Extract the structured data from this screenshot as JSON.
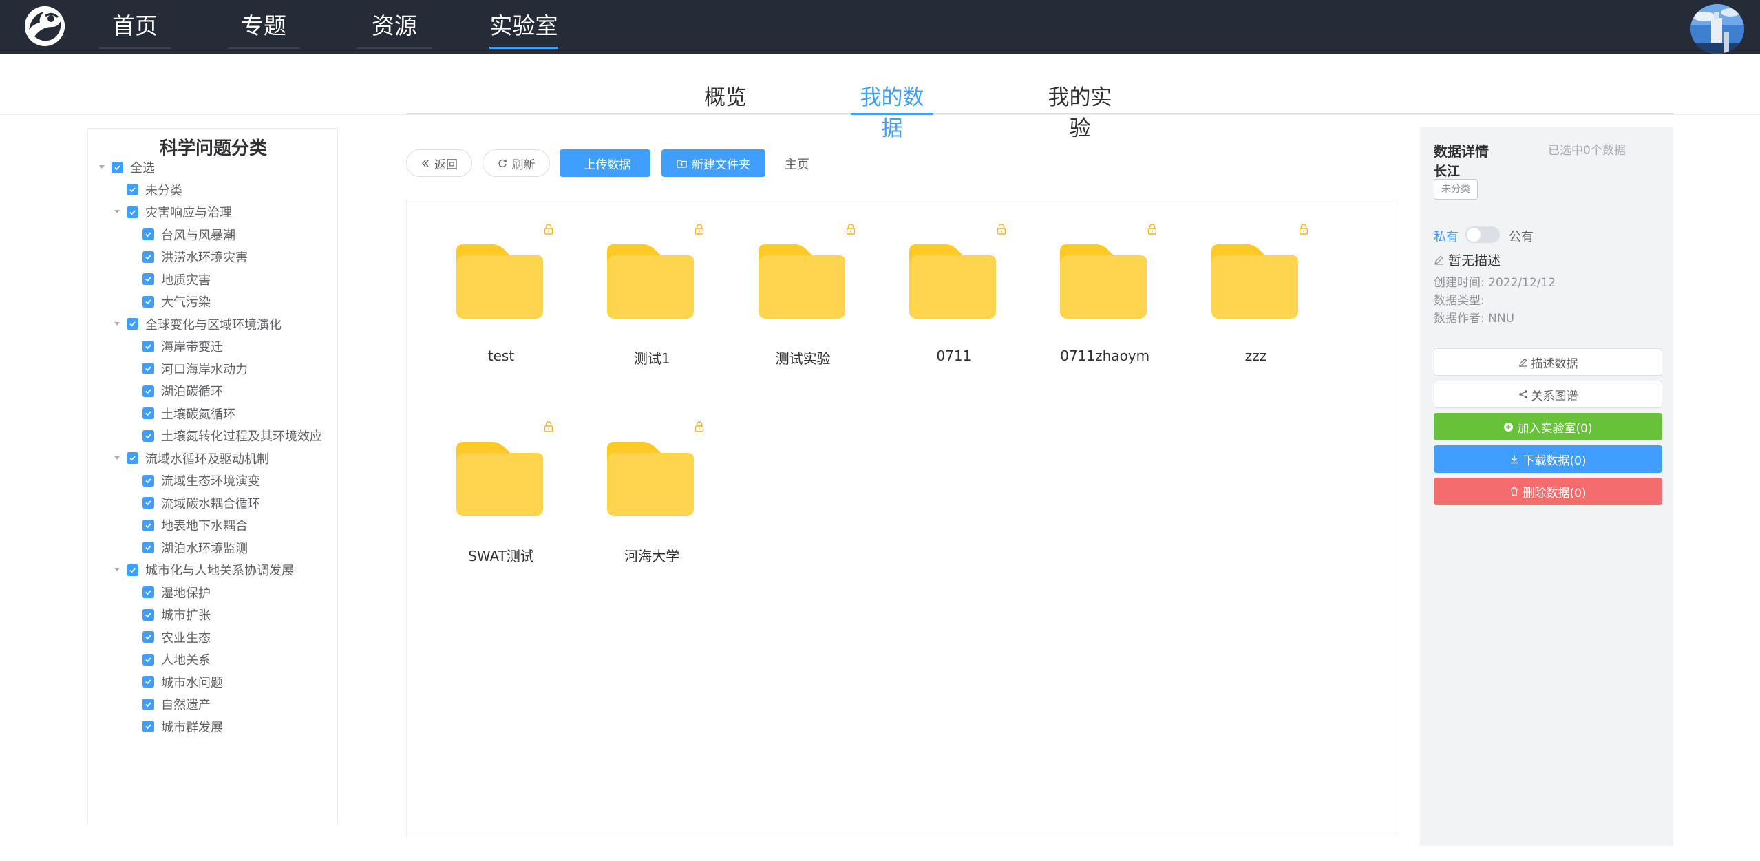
{
  "nav": {
    "items": [
      {
        "label": "首页",
        "active": false
      },
      {
        "label": "专题",
        "active": false
      },
      {
        "label": "资源",
        "active": false
      },
      {
        "label": "实验室",
        "active": true
      }
    ]
  },
  "subtabs": [
    {
      "label": "概览",
      "active": false
    },
    {
      "label": "我的数据",
      "active": true
    },
    {
      "label": "我的实验",
      "active": false
    }
  ],
  "tree": {
    "title": "科学问题分类",
    "nodes": [
      {
        "label": "全选",
        "level": 0,
        "expandable": true,
        "checked": true
      },
      {
        "label": "未分类",
        "level": 1,
        "expandable": false,
        "checked": true
      },
      {
        "label": "灾害响应与治理",
        "level": 1,
        "expandable": true,
        "checked": true
      },
      {
        "label": "台风与风暴潮",
        "level": 2,
        "expandable": false,
        "checked": true
      },
      {
        "label": "洪涝水环境灾害",
        "level": 2,
        "expandable": false,
        "checked": true
      },
      {
        "label": "地质灾害",
        "level": 2,
        "expandable": false,
        "checked": true
      },
      {
        "label": "大气污染",
        "level": 2,
        "expandable": false,
        "checked": true
      },
      {
        "label": "全球变化与区域环境演化",
        "level": 1,
        "expandable": true,
        "checked": true
      },
      {
        "label": "海岸带变迁",
        "level": 2,
        "expandable": false,
        "checked": true
      },
      {
        "label": "河口海岸水动力",
        "level": 2,
        "expandable": false,
        "checked": true
      },
      {
        "label": "湖泊碳循环",
        "level": 2,
        "expandable": false,
        "checked": true
      },
      {
        "label": "土壤碳氮循环",
        "level": 2,
        "expandable": false,
        "checked": true
      },
      {
        "label": "土壤氮转化过程及其环境效应",
        "level": 2,
        "expandable": false,
        "checked": true
      },
      {
        "label": "流域水循环及驱动机制",
        "level": 1,
        "expandable": true,
        "checked": true
      },
      {
        "label": "流域生态环境演变",
        "level": 2,
        "expandable": false,
        "checked": true
      },
      {
        "label": "流域碳水耦合循环",
        "level": 2,
        "expandable": false,
        "checked": true
      },
      {
        "label": "地表地下水耦合",
        "level": 2,
        "expandable": false,
        "checked": true
      },
      {
        "label": "湖泊水环境监测",
        "level": 2,
        "expandable": false,
        "checked": true
      },
      {
        "label": "城市化与人地关系协调发展",
        "level": 1,
        "expandable": true,
        "checked": true
      },
      {
        "label": "湿地保护",
        "level": 2,
        "expandable": false,
        "checked": true
      },
      {
        "label": "城市扩张",
        "level": 2,
        "expandable": false,
        "checked": true
      },
      {
        "label": "农业生态",
        "level": 2,
        "expandable": false,
        "checked": true
      },
      {
        "label": "人地关系",
        "level": 2,
        "expandable": false,
        "checked": true
      },
      {
        "label": "城市水问题",
        "level": 2,
        "expandable": false,
        "checked": true
      },
      {
        "label": "自然遗产",
        "level": 2,
        "expandable": false,
        "checked": true
      },
      {
        "label": "城市群发展",
        "level": 2,
        "expandable": false,
        "checked": true
      }
    ]
  },
  "toolbar": {
    "back_label": "返回",
    "refresh_label": "刷新",
    "upload_label": "上传数据",
    "new_folder_label": "新建文件夹",
    "breadcrumb": "主页"
  },
  "files": [
    {
      "name": "test",
      "locked": true
    },
    {
      "name": "测试1",
      "locked": true
    },
    {
      "name": "测试实验",
      "locked": true
    },
    {
      "name": "0711",
      "locked": true
    },
    {
      "name": "0711zhaoym",
      "locked": true
    },
    {
      "name": "zzz",
      "locked": true
    },
    {
      "name": "SWAT测试",
      "locked": true
    },
    {
      "name": "河海大学",
      "locked": true
    }
  ],
  "details": {
    "title": "数据详情",
    "selected_count": "已选中0个数据",
    "name": "长江",
    "tag": "未分类",
    "private_label": "私有",
    "public_label": "公有",
    "description": "暂无描述",
    "created": "创建时间:  2022/12/12",
    "data_type": "数据类型:",
    "author": "数据作者:  NNU",
    "describe_btn": "描述数据",
    "graph_btn": "关系图谱",
    "add_lab_btn": "加入实验室(0)",
    "download_btn": "下载数据(0)",
    "delete_btn": "删除数据(0)"
  },
  "colors": {
    "accent": "#409eff",
    "topbar": "#252c38",
    "folder": "#ffd54f",
    "folder_tab": "#ffca28",
    "lock": "#f0b429",
    "green": "#67c23a",
    "red": "#f56c6c"
  }
}
